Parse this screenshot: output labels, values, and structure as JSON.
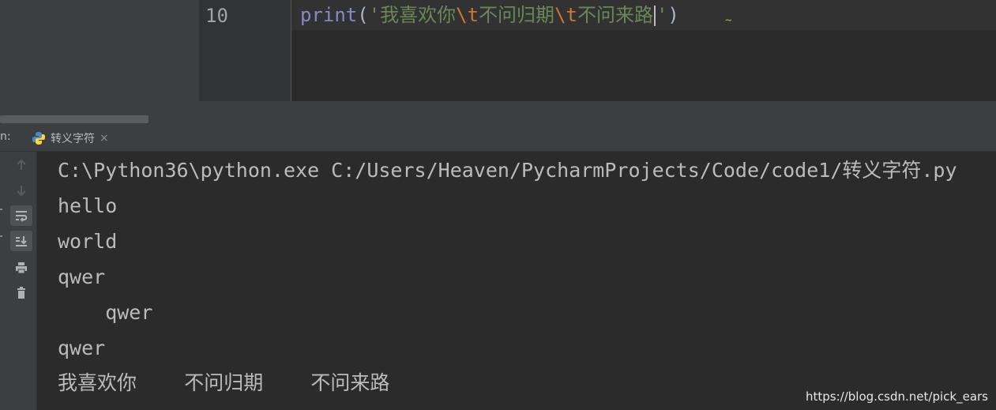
{
  "editor": {
    "line_number": "10",
    "code": {
      "func": "print",
      "open_paren": "(",
      "open_quote": "'",
      "str_part1": "我喜欢你",
      "escape1": "\\t",
      "str_part2": "不问归期",
      "escape2": "\\t",
      "str_part3": "不问来路",
      "close_quote": "'",
      "close_paren": ")"
    }
  },
  "run_window": {
    "label": "n:",
    "tab": {
      "title": "转义字符",
      "icon": "python-icon",
      "close": "×"
    },
    "toolbar": {
      "buttons": [
        "up-arrow-icon",
        "down-arrow-icon",
        "soft-wrap-icon",
        "scroll-to-end-icon",
        "print-icon",
        "trash-icon"
      ]
    }
  },
  "console": {
    "lines": [
      "C:\\Python36\\python.exe C:/Users/Heaven/PycharmProjects/Code/code1/转义字符.py",
      "hello",
      "world",
      "qwer",
      "    qwer",
      "qwer",
      "我喜欢你    不问归期    不问来路"
    ]
  },
  "watermark": "https://blog.csdn.net/pick_ears",
  "colors": {
    "editor_bg": "#2b2b2b",
    "panel_bg": "#3c3f41",
    "keyword": "#8888c6",
    "string": "#6a8759",
    "escape": "#cc7832",
    "console_text": "#bbbbbb"
  }
}
